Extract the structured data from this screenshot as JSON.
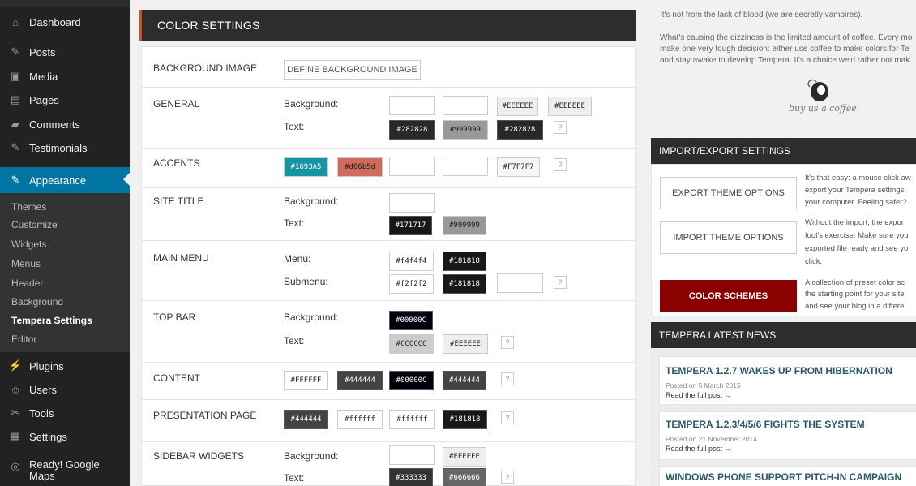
{
  "sidebar": {
    "items": [
      {
        "label": "Dashboard",
        "icon": "dashboard-icon",
        "glyph": "⌂"
      },
      {
        "label": "Posts",
        "icon": "pin-icon",
        "glyph": "✎"
      },
      {
        "label": "Media",
        "icon": "media-icon",
        "glyph": "▣"
      },
      {
        "label": "Pages",
        "icon": "pages-icon",
        "glyph": "▤"
      },
      {
        "label": "Comments",
        "icon": "comments-icon",
        "glyph": "▰"
      },
      {
        "label": "Testimonials",
        "icon": "pin-icon",
        "glyph": "✎"
      },
      {
        "label": "Appearance",
        "icon": "brush-icon",
        "glyph": "✎"
      },
      {
        "label": "Plugins",
        "icon": "plug-icon",
        "glyph": "⚡"
      },
      {
        "label": "Users",
        "icon": "user-icon",
        "glyph": "☺"
      },
      {
        "label": "Tools",
        "icon": "wrench-icon",
        "glyph": "✂"
      },
      {
        "label": "Settings",
        "icon": "settings-icon",
        "glyph": "▦"
      },
      {
        "label": "Ready! Google Maps",
        "icon": "globe-icon",
        "glyph": "◎"
      }
    ],
    "submenu": [
      "Themes",
      "Customize",
      "Widgets",
      "Menus",
      "Header",
      "Background",
      "Tempera Settings",
      "Editor"
    ],
    "current_sub": "Tempera Settings"
  },
  "main": {
    "title": "COLOR SETTINGS",
    "help_glyph": "?",
    "rows": {
      "bg_image": {
        "label": "BACKGROUND IMAGE",
        "button": "DEFINE BACKGROUND IMAGE"
      },
      "general": {
        "label": "GENERAL",
        "bg_label": "Background:",
        "text_label": "Text:",
        "bg_values": [
          "",
          "",
          "#EEEEEE",
          "#EEEEEE"
        ],
        "text_values": [
          "#282828",
          "#999999",
          "#282828"
        ]
      },
      "accents": {
        "label": "ACCENTS",
        "values": [
          "#1693A5",
          "#d06b5d",
          "",
          "",
          "#F7F7F7"
        ]
      },
      "site_title": {
        "label": "SITE TITLE",
        "bg_label": "Background:",
        "text_label": "Text:",
        "bg_values": [
          ""
        ],
        "text_values": [
          "#171717",
          "#999999"
        ]
      },
      "main_menu": {
        "label": "MAIN MENU",
        "menu_label": "Menu:",
        "submenu_label": "Submenu:",
        "menu_values": [
          "#f4f4f4",
          "#181818"
        ],
        "submenu_values": [
          "#f2f2f2",
          "#181818",
          ""
        ]
      },
      "top_bar": {
        "label": "TOP BAR",
        "bg_label": "Background:",
        "text_label": "Text:",
        "bg_values": [
          "#00000C"
        ],
        "text_values": [
          "#CCCCCC",
          "#EEEEEE"
        ]
      },
      "content": {
        "label": "CONTENT",
        "values": [
          "#FFFFFF",
          "#444444",
          "#00000C",
          "#444444"
        ]
      },
      "presentation": {
        "label": "PRESENTATION PAGE",
        "values": [
          "#444444",
          "#ffffff",
          "#ffffff",
          "#181818"
        ]
      },
      "sidebar_widgets": {
        "label": "SIDEBAR WIDGETS",
        "bg_label": "Background:",
        "text_label": "Text:",
        "bg_values": [
          "",
          "#EEEEEE"
        ],
        "text_values": [
          "#333333",
          "#666666"
        ]
      }
    }
  },
  "right": {
    "intro": [
      "It's not from the lack of blood (we are secretly vampires).",
      "What's causing the dizziness is the limited amount of coffee. Every mo",
      "make one very tough decision: either use coffee to make colors for Te",
      "and stay awake to develop Tempera. It's a choice we'd rather not mak"
    ],
    "coffee_label": "buy us a coffee",
    "import_export": {
      "title": "IMPORT/EXPORT SETTINGS",
      "export_button": "EXPORT THEME OPTIONS",
      "export_desc": [
        "It's that easy: a mouse click aw",
        "export your Tempera settings",
        "your computer. Feeling safer?"
      ],
      "import_button": "IMPORT THEME OPTIONS",
      "import_desc": [
        "Without the import, the expor",
        "fool's exercise. Make sure you",
        "exported file ready and see yo",
        "click."
      ],
      "schemes_button": "COLOR SCHEMES",
      "schemes_desc": [
        "A collection of preset color sc",
        "the starting point for your site",
        "and see your blog in a differe"
      ]
    },
    "news": {
      "title": "TEMPERA LATEST NEWS",
      "items": [
        {
          "title": "TEMPERA 1.2.7 WAKES UP FROM HIBERNATION",
          "date": "Posted on 5 March 2015",
          "link": "Read the full post →"
        },
        {
          "title": "TEMPERA 1.2.3/4/5/6 FIGHTS THE SYSTEM",
          "date": "Posted on 21 November 2014",
          "link": "Read the full post →"
        },
        {
          "title": "WINDOWS PHONE SUPPORT PITCH-IN CAMPAIGN",
          "date": "",
          "link": ""
        }
      ]
    }
  }
}
